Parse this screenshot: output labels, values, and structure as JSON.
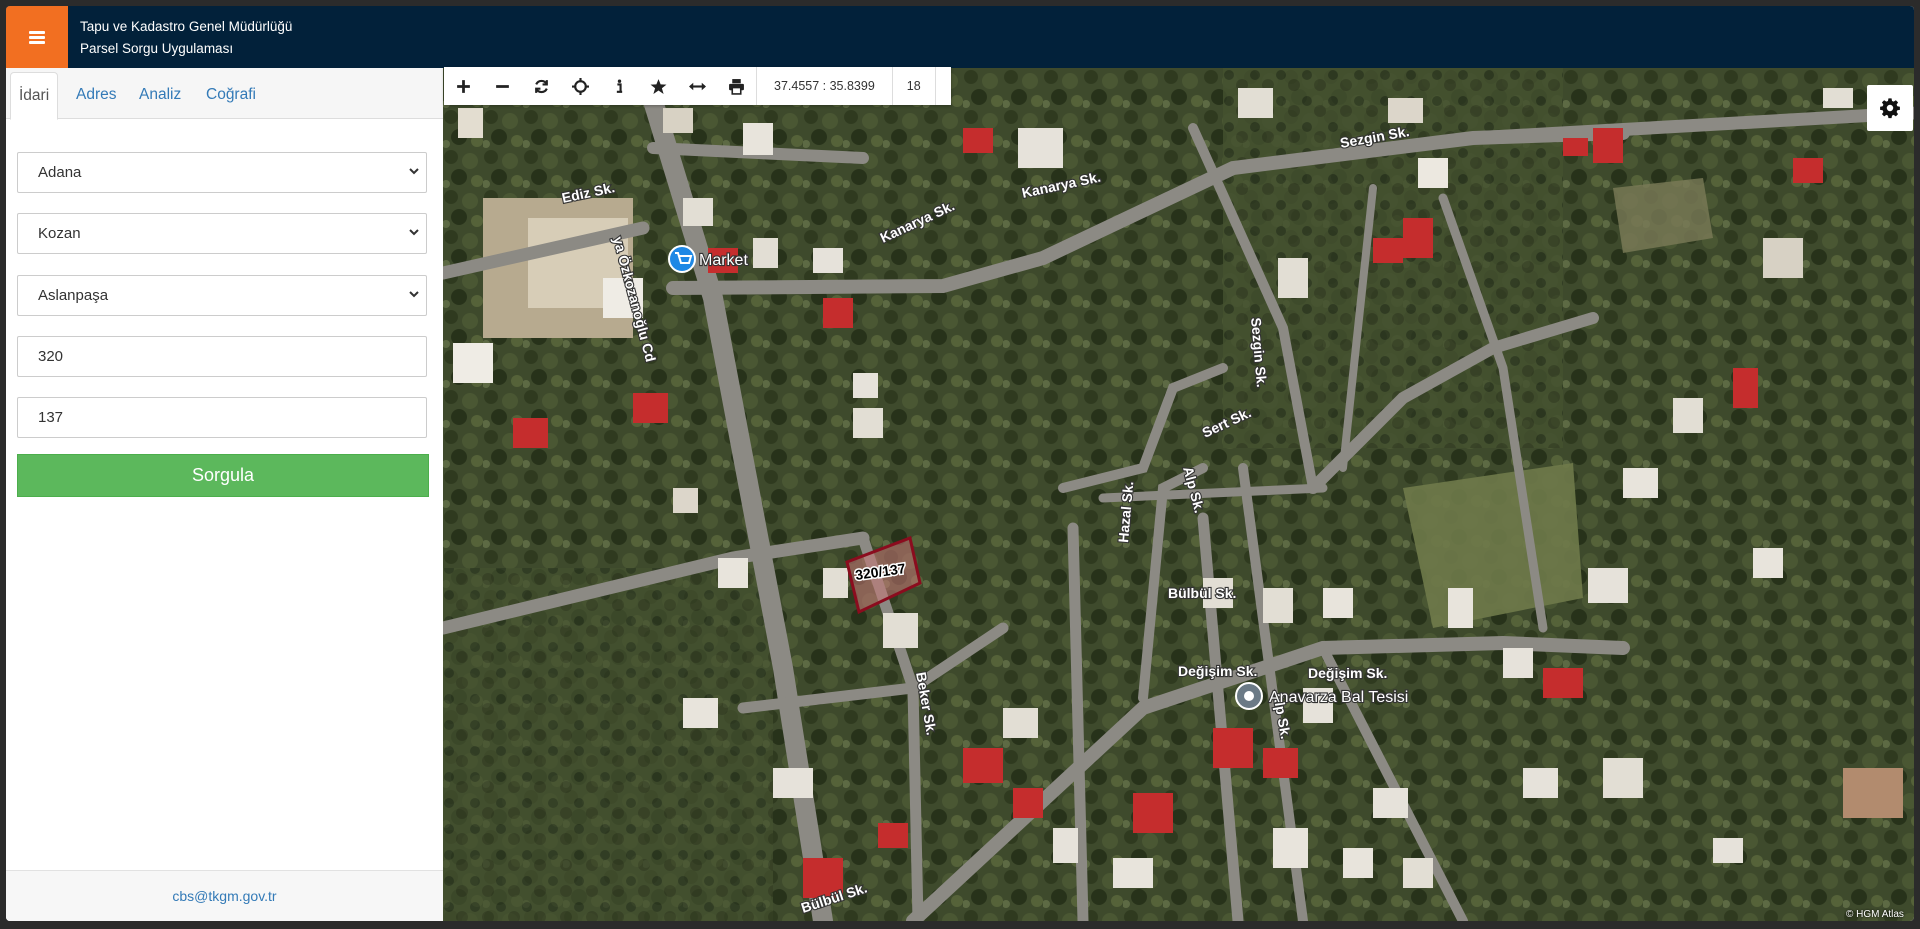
{
  "header": {
    "title_line1": "Tapu ve Kadastro Genel Müdürlüğü",
    "title_line2": "Parsel Sorgu Uygulaması"
  },
  "tabs": [
    {
      "label": "İdari"
    },
    {
      "label": "Adres"
    },
    {
      "label": "Analiz"
    },
    {
      "label": "Coğrafi"
    }
  ],
  "form": {
    "province": "Adana",
    "district": "Kozan",
    "neighborhood": "Aslanpaşa",
    "block": "320",
    "parcel": "137",
    "submit_label": "Sorgula"
  },
  "footer": {
    "email": "cbs@tkgm.gov.tr"
  },
  "map_toolbar": {
    "coordinates": "37.4557 : 35.8399",
    "zoom": "18"
  },
  "map": {
    "parcel_label": "320/137",
    "attribution": "© HGM Atlas",
    "pois": [
      {
        "name": "Market"
      },
      {
        "name": "Anavarza Bal Tesisi"
      }
    ],
    "streets": [
      "Ediz Sk.",
      "ya Özkozanoğlu Cd",
      "Kanarya Sk.",
      "Kanarya Sk.",
      "Sezgin Sk.",
      "Sezgin Sk.",
      "Sert Sk.",
      "Alp Sk.",
      "Hazal Sk.",
      "Bülbül Sk.",
      "Değişim Sk.",
      "Değişim Sk.",
      "Beker Sk.",
      "Bülbül Sk.",
      "Alp Sk."
    ]
  },
  "colors": {
    "header_bg": "#02213a",
    "menu_accent": "#f26f21",
    "submit_green": "#5cb85c",
    "link_blue": "#337ab7",
    "parcel_outline": "#8b0c1e"
  },
  "icons": [
    "menu-icon",
    "zoom-in-icon",
    "zoom-out-icon",
    "refresh-icon",
    "locate-icon",
    "info-icon",
    "star-icon",
    "measure-icon",
    "print-icon",
    "gear-icon",
    "cart-icon",
    "pin-icon"
  ]
}
